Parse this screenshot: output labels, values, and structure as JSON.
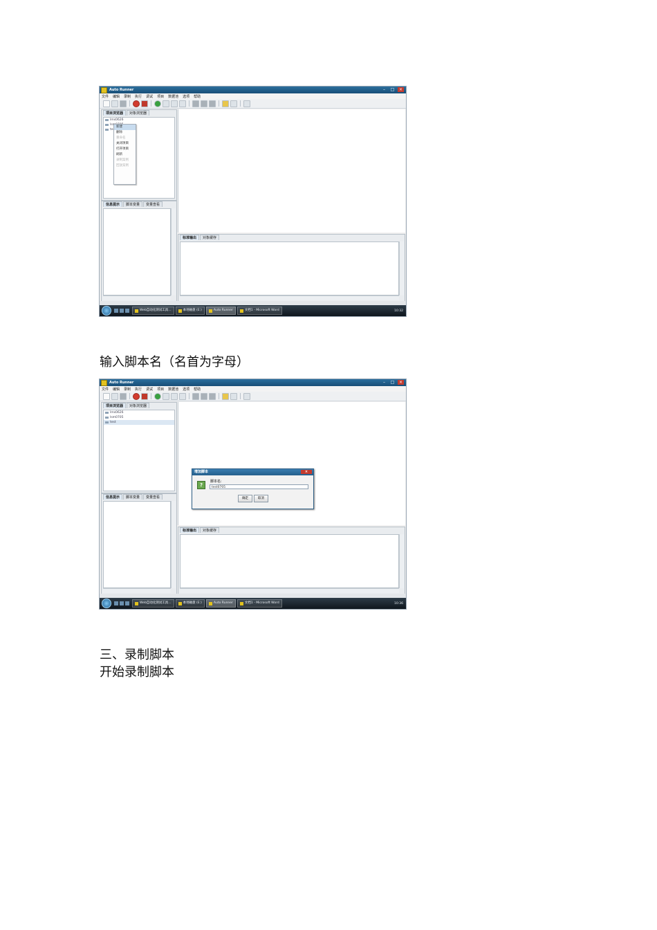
{
  "app": {
    "title": "Auto Runner",
    "menu": [
      "文件",
      "编辑",
      "录制",
      "执行",
      "调试",
      "项目",
      "数据池",
      "选项",
      "帮助"
    ],
    "left_top_tabs": [
      "项目浏览器",
      "对象浏览器"
    ],
    "left_bottom_tabs": [
      "信息提示",
      "脚本变量",
      "变量查看"
    ],
    "output_tabs": [
      "标准输出",
      "对象缓存"
    ],
    "taskbar": {
      "items": [
        "Web自动化测试工具...",
        "本地磁盘 (E:)",
        "Auto Runner",
        "文档1 - Microsoft Word"
      ]
    }
  },
  "screenshot1": {
    "tree": [
      "Ims0626",
      "Ism0705",
      "test"
    ],
    "context_menu": [
      {
        "label": "新建",
        "state": "highlighted"
      },
      {
        "label": "删除",
        "state": "enabled"
      },
      {
        "label": "重命名",
        "state": "disabled"
      },
      {
        "label": "关闭项目",
        "state": "enabled"
      },
      {
        "label": "打开项目",
        "state": "enabled"
      },
      {
        "label": "刷新",
        "state": "enabled"
      },
      {
        "label": "录制案例",
        "state": "disabled"
      },
      {
        "label": "回放案例",
        "state": "disabled"
      }
    ],
    "clock": "10:32"
  },
  "screenshot2": {
    "tree": [
      "Ims0626",
      "Ism0705",
      "test"
    ],
    "dialog": {
      "title": "增加脚本",
      "label": "脚本名:",
      "value": "test0705",
      "ok": "确定",
      "cancel": "取消"
    },
    "clock": "10:36"
  },
  "text": {
    "caption_enter_name": "输入脚本名（名首为字母）",
    "section_heading": "三、录制脚本",
    "caption_start_record": "开始录制脚本"
  }
}
